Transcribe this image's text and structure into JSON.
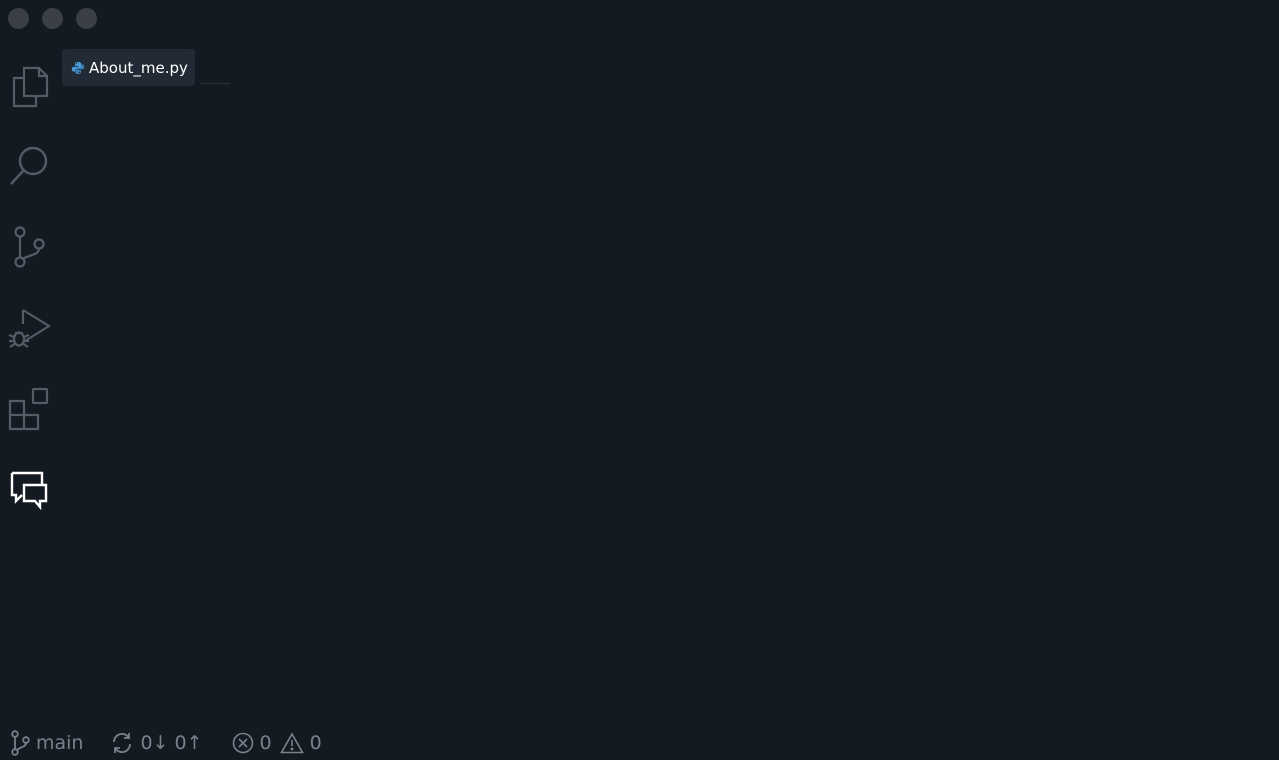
{
  "window": {
    "traffic_lights": [
      "close",
      "minimize",
      "maximize"
    ]
  },
  "activity_bar": {
    "items": [
      {
        "name": "explorer",
        "icon": "files-icon"
      },
      {
        "name": "search",
        "icon": "search-icon"
      },
      {
        "name": "source-control",
        "icon": "source-control-icon"
      },
      {
        "name": "run-and-debug",
        "icon": "run-debug-icon"
      },
      {
        "name": "extensions",
        "icon": "extensions-icon"
      },
      {
        "name": "chat",
        "icon": "chat-icon",
        "active": true
      }
    ]
  },
  "editor": {
    "tab": {
      "label": "About_me.py",
      "icon": "python-icon",
      "icon_color": "#4b9bd6"
    }
  },
  "status_bar": {
    "branch": "main",
    "sync_down": "0↓",
    "sync_up": "0↑",
    "errors": "0",
    "warnings": "0"
  },
  "colors": {
    "background": "#141a22",
    "tab_background": "#222a36",
    "icon_inactive": "#565c66",
    "icon_active": "#ffffff",
    "status_text": "#7a818b"
  }
}
